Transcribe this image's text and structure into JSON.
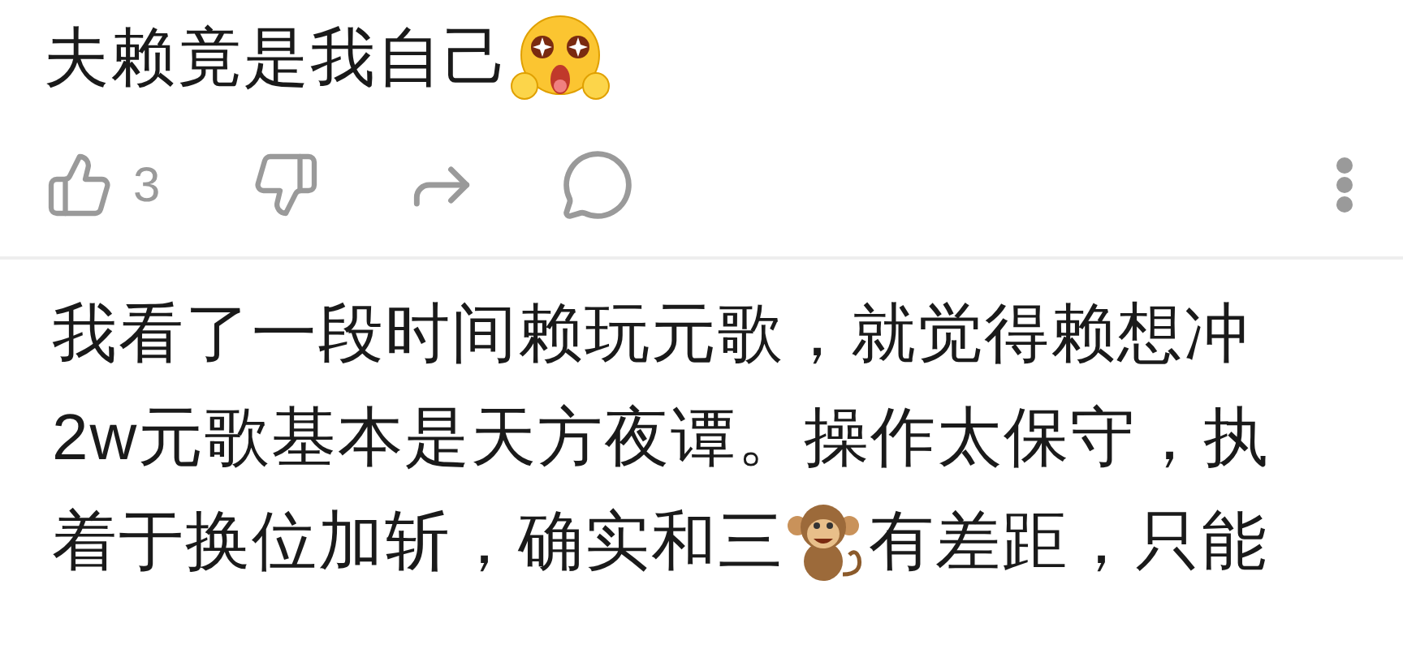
{
  "comment": {
    "text": "夫赖竟是我自己",
    "actions": {
      "like_count": "3"
    }
  },
  "reply": {
    "lines": [
      [
        {
          "kind": "text",
          "text": "我看了一段时间赖玩元歌，就觉得赖想冲"
        }
      ],
      [
        {
          "kind": "text",
          "text": "2w元歌基本是天方夜谭。操作太保守，执"
        }
      ],
      [
        {
          "kind": "text",
          "text": "着于换位加斩，确实和三"
        },
        {
          "kind": "emoji"
        },
        {
          "kind": "text",
          "text": "有差距，只能"
        }
      ]
    ]
  }
}
